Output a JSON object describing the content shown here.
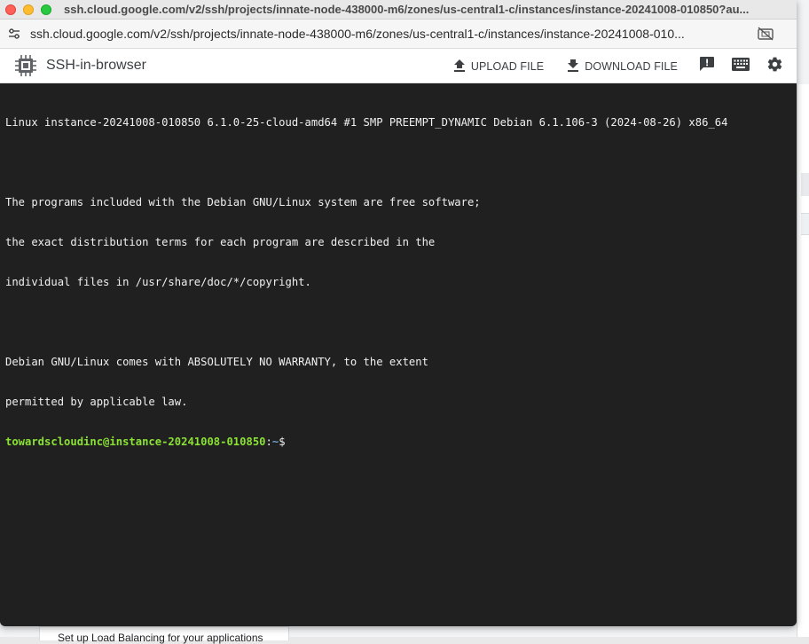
{
  "window": {
    "title": "ssh.cloud.google.com/v2/ssh/projects/innate-node-438000-m6/zones/us-central1-c/instances/instance-20241008-010850?au...",
    "url": "ssh.cloud.google.com/v2/ssh/projects/innate-node-438000-m6/zones/us-central1-c/instances/instance-20241008-010..."
  },
  "app": {
    "title": "SSH-in-browser",
    "upload_label": "UPLOAD FILE",
    "download_label": "DOWNLOAD FILE",
    "icons": [
      "chip-icon",
      "upload-icon",
      "download-icon",
      "feedback-icon",
      "keyboard-icon",
      "gear-icon"
    ]
  },
  "terminal": {
    "lines": [
      "Linux instance-20241008-010850 6.1.0-25-cloud-amd64 #1 SMP PREEMPT_DYNAMIC Debian 6.1.106-3 (2024-08-26) x86_64",
      "",
      "The programs included with the Debian GNU/Linux system are free software;",
      "the exact distribution terms for each program are described in the",
      "individual files in /usr/share/doc/*/copyright.",
      "",
      "Debian GNU/Linux comes with ABSOLUTELY NO WARRANTY, to the extent",
      "permitted by applicable law."
    ],
    "prompt_user": "towardscloudinc@instance-20241008-010850",
    "prompt_sep": ":",
    "prompt_path": "~",
    "prompt_symbol": "$"
  },
  "background": {
    "card_text": "Set up Load Balancing for your applications"
  },
  "colors": {
    "terminal_bg": "#202020",
    "prompt_user": "#8ae234",
    "prompt_path": "#729fcf"
  }
}
